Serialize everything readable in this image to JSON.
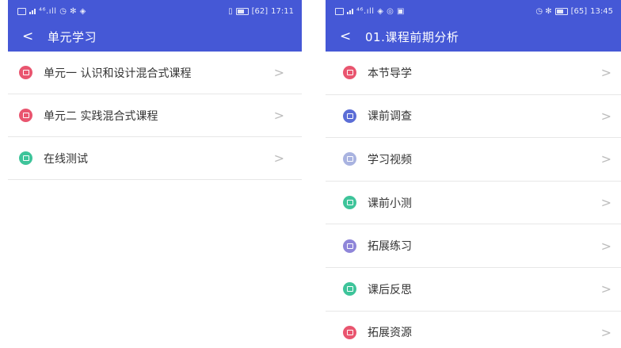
{
  "left": {
    "status": {
      "left_text": "⁴⁶.ıll ◷ ✻ ◈",
      "time": "17:11",
      "battery": "[62]"
    },
    "title": "单元学习",
    "back": "<",
    "items": [
      {
        "label": "单元一 认识和设计混合式课程",
        "icon": "document-icon",
        "color": "#e9556f"
      },
      {
        "label": "单元二 实践混合式课程",
        "icon": "play-icon",
        "color": "#e9556f"
      },
      {
        "label": "在线测试",
        "icon": "quiz-icon",
        "color": "#3ec49a"
      }
    ],
    "chevron": ">"
  },
  "right": {
    "status": {
      "left_text": "⁴⁶.ıll ◈ ◎ ▣",
      "time": "13:45",
      "battery": "[65]"
    },
    "title": "01.课程前期分析",
    "back": "<",
    "items": [
      {
        "label": "本节导学",
        "icon": "guide-icon",
        "color": "#e9556f"
      },
      {
        "label": "课前调查",
        "icon": "survey-icon",
        "color": "#5b6dd6"
      },
      {
        "label": "学习视频",
        "icon": "video-icon",
        "color": "#a9b3e0"
      },
      {
        "label": "课前小测",
        "icon": "quiz-icon",
        "color": "#3ec49a"
      },
      {
        "label": "拓展练习",
        "icon": "edit-icon",
        "color": "#8f86d9"
      },
      {
        "label": "课后反思",
        "icon": "chat-icon",
        "color": "#3ec49a"
      },
      {
        "label": "拓展资源",
        "icon": "resource-icon",
        "color": "#e9556f"
      }
    ],
    "chevron": ">"
  }
}
